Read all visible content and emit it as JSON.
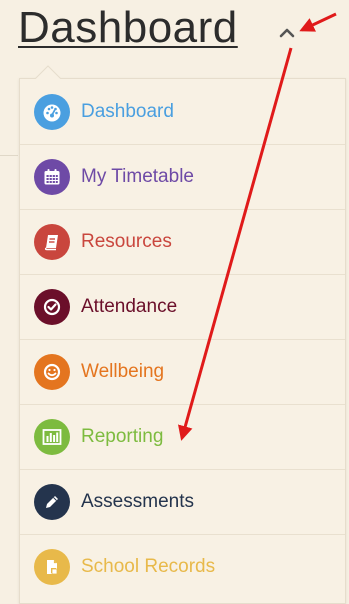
{
  "header": {
    "title": "Dashboard"
  },
  "menu": {
    "items": [
      {
        "label": "Dashboard",
        "icon": "dashboard-gauge-icon",
        "color": "#4a9fe0"
      },
      {
        "label": "My Timetable",
        "icon": "calendar-icon",
        "color": "#6e4aa6"
      },
      {
        "label": "Resources",
        "icon": "book-icon",
        "color": "#c9463d"
      },
      {
        "label": "Attendance",
        "icon": "check-circle-icon",
        "color": "#6b0f2a"
      },
      {
        "label": "Wellbeing",
        "icon": "smiley-icon",
        "color": "#e4751f"
      },
      {
        "label": "Reporting",
        "icon": "bar-chart-icon",
        "color": "#7dbb3f"
      },
      {
        "label": "Assessments",
        "icon": "pencil-icon",
        "color": "#24344d"
      },
      {
        "label": "School Records",
        "icon": "document-icon",
        "color": "#e8b94a"
      }
    ]
  },
  "annotations": {
    "arrow_color": "#e01a1a"
  }
}
